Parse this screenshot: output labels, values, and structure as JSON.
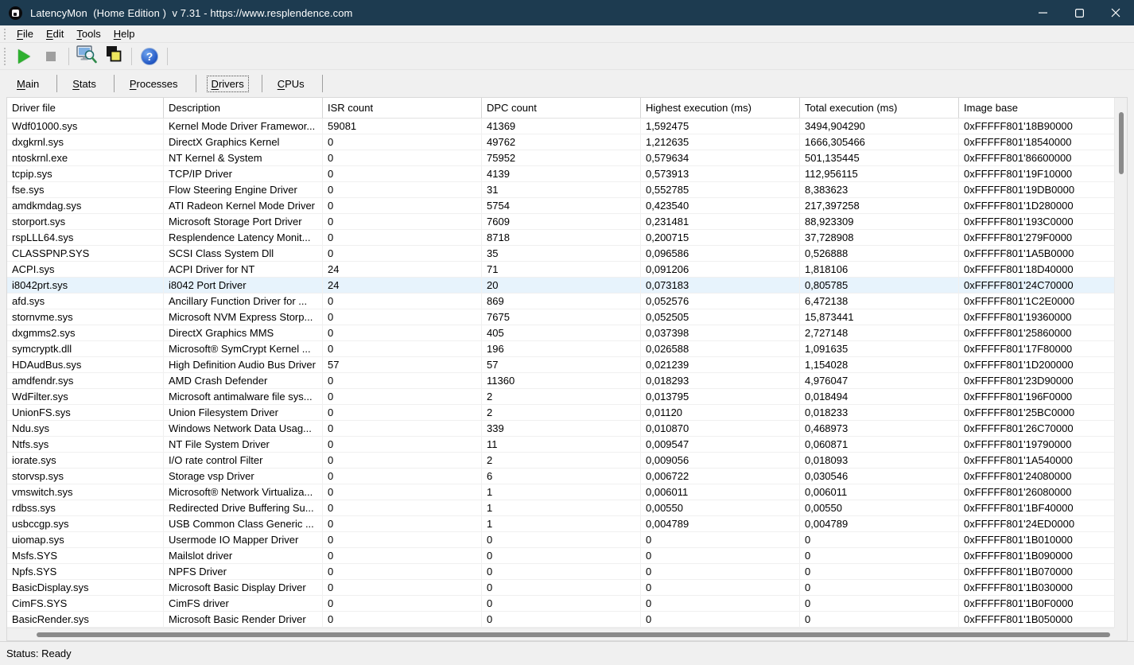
{
  "titlebar": {
    "title": "LatencyMon  (Home Edition )  v 7.31 - https://www.resplendence.com"
  },
  "icons": {
    "app": "latencymon-logo",
    "play": "start-monitor",
    "stop": "stop-monitor",
    "analyze": "latency-test-monitor-magnifier",
    "copy": "copy-report-overlapping-squares",
    "help_glyph": "?",
    "minimize": "minimize-line",
    "maximize": "maximize-square",
    "close": "close-x"
  },
  "menu": {
    "items": [
      "File",
      "Edit",
      "Tools",
      "Help"
    ]
  },
  "tabs": {
    "items": [
      "Main",
      "Stats",
      "Processes",
      "Drivers",
      "CPUs"
    ],
    "active": "Drivers"
  },
  "table": {
    "columns": [
      "Driver file",
      "Description",
      "ISR count",
      "DPC count",
      "Highest execution (ms)",
      "Total execution (ms)",
      "Image base"
    ],
    "selected_row": 10,
    "rows": [
      [
        "Wdf01000.sys",
        "Kernel Mode Driver Framewor...",
        "59081",
        "41369",
        "1,592475",
        "3494,904290",
        "0xFFFFF801'18B90000"
      ],
      [
        "dxgkrnl.sys",
        "DirectX Graphics Kernel",
        "0",
        "49762",
        "1,212635",
        "1666,305466",
        "0xFFFFF801'18540000"
      ],
      [
        "ntoskrnl.exe",
        "NT Kernel & System",
        "0",
        "75952",
        "0,579634",
        "501,135445",
        "0xFFFFF801'86600000"
      ],
      [
        "tcpip.sys",
        "TCP/IP Driver",
        "0",
        "4139",
        "0,573913",
        "112,956115",
        "0xFFFFF801'19F10000"
      ],
      [
        "fse.sys",
        "Flow Steering Engine Driver",
        "0",
        "31",
        "0,552785",
        "8,383623",
        "0xFFFFF801'19DB0000"
      ],
      [
        "amdkmdag.sys",
        "ATI Radeon Kernel Mode Driver",
        "0",
        "5754",
        "0,423540",
        "217,397258",
        "0xFFFFF801'1D280000"
      ],
      [
        "storport.sys",
        "Microsoft Storage Port Driver",
        "0",
        "7609",
        "0,231481",
        "88,923309",
        "0xFFFFF801'193C0000"
      ],
      [
        "rspLLL64.sys",
        "Resplendence Latency Monit...",
        "0",
        "8718",
        "0,200715",
        "37,728908",
        "0xFFFFF801'279F0000"
      ],
      [
        "CLASSPNP.SYS",
        "SCSI Class System Dll",
        "0",
        "35",
        "0,096586",
        "0,526888",
        "0xFFFFF801'1A5B0000"
      ],
      [
        "ACPI.sys",
        "ACPI Driver for NT",
        "24",
        "71",
        "0,091206",
        "1,818106",
        "0xFFFFF801'18D40000"
      ],
      [
        "i8042prt.sys",
        "i8042 Port Driver",
        "24",
        "20",
        "0,073183",
        "0,805785",
        "0xFFFFF801'24C70000"
      ],
      [
        "afd.sys",
        "Ancillary Function Driver for ...",
        "0",
        "869",
        "0,052576",
        "6,472138",
        "0xFFFFF801'1C2E0000"
      ],
      [
        "stornvme.sys",
        "Microsoft NVM Express Storp...",
        "0",
        "7675",
        "0,052505",
        "15,873441",
        "0xFFFFF801'19360000"
      ],
      [
        "dxgmms2.sys",
        "DirectX Graphics MMS",
        "0",
        "405",
        "0,037398",
        "2,727148",
        "0xFFFFF801'25860000"
      ],
      [
        "symcryptk.dll",
        "Microsoft® SymCrypt Kernel ...",
        "0",
        "196",
        "0,026588",
        "1,091635",
        "0xFFFFF801'17F80000"
      ],
      [
        "HDAudBus.sys",
        "High Definition Audio Bus Driver",
        "57",
        "57",
        "0,021239",
        "1,154028",
        "0xFFFFF801'1D200000"
      ],
      [
        "amdfendr.sys",
        "AMD Crash Defender",
        "0",
        "11360",
        "0,018293",
        "4,976047",
        "0xFFFFF801'23D90000"
      ],
      [
        "WdFilter.sys",
        "Microsoft antimalware file sys...",
        "0",
        "2",
        "0,013795",
        "0,018494",
        "0xFFFFF801'196F0000"
      ],
      [
        "UnionFS.sys",
        "Union Filesystem Driver",
        "0",
        "2",
        "0,01120",
        "0,018233",
        "0xFFFFF801'25BC0000"
      ],
      [
        "Ndu.sys",
        "Windows Network Data Usag...",
        "0",
        "339",
        "0,010870",
        "0,468973",
        "0xFFFFF801'26C70000"
      ],
      [
        "Ntfs.sys",
        "NT File System Driver",
        "0",
        "11",
        "0,009547",
        "0,060871",
        "0xFFFFF801'19790000"
      ],
      [
        "iorate.sys",
        "I/O rate control Filter",
        "0",
        "2",
        "0,009056",
        "0,018093",
        "0xFFFFF801'1A540000"
      ],
      [
        "storvsp.sys",
        "Storage vsp Driver",
        "0",
        "6",
        "0,006722",
        "0,030546",
        "0xFFFFF801'24080000"
      ],
      [
        "vmswitch.sys",
        "Microsoft® Network Virtualiza...",
        "0",
        "1",
        "0,006011",
        "0,006011",
        "0xFFFFF801'26080000"
      ],
      [
        "rdbss.sys",
        "Redirected Drive Buffering Su...",
        "0",
        "1",
        "0,00550",
        "0,00550",
        "0xFFFFF801'1BF40000"
      ],
      [
        "usbccgp.sys",
        "USB Common Class Generic ...",
        "0",
        "1",
        "0,004789",
        "0,004789",
        "0xFFFFF801'24ED0000"
      ],
      [
        "uiomap.sys",
        "Usermode IO Mapper Driver",
        "0",
        "0",
        "0",
        "0",
        "0xFFFFF801'1B010000"
      ],
      [
        "Msfs.SYS",
        "Mailslot driver",
        "0",
        "0",
        "0",
        "0",
        "0xFFFFF801'1B090000"
      ],
      [
        "Npfs.SYS",
        "NPFS Driver",
        "0",
        "0",
        "0",
        "0",
        "0xFFFFF801'1B070000"
      ],
      [
        "BasicDisplay.sys",
        "Microsoft Basic Display Driver",
        "0",
        "0",
        "0",
        "0",
        "0xFFFFF801'1B030000"
      ],
      [
        "CimFS.SYS",
        "CimFS driver",
        "0",
        "0",
        "0",
        "0",
        "0xFFFFF801'1B0F0000"
      ],
      [
        "BasicRender.sys",
        "Microsoft Basic Render Driver",
        "0",
        "0",
        "0",
        "0",
        "0xFFFFF801'1B050000"
      ]
    ]
  },
  "statusbar": {
    "text": "Status: Ready"
  },
  "colors": {
    "titlebar": "#1d3b50",
    "selected_row": "#e7f3fc",
    "play_green": "#2eb030",
    "help_blue": "#2257c4"
  }
}
